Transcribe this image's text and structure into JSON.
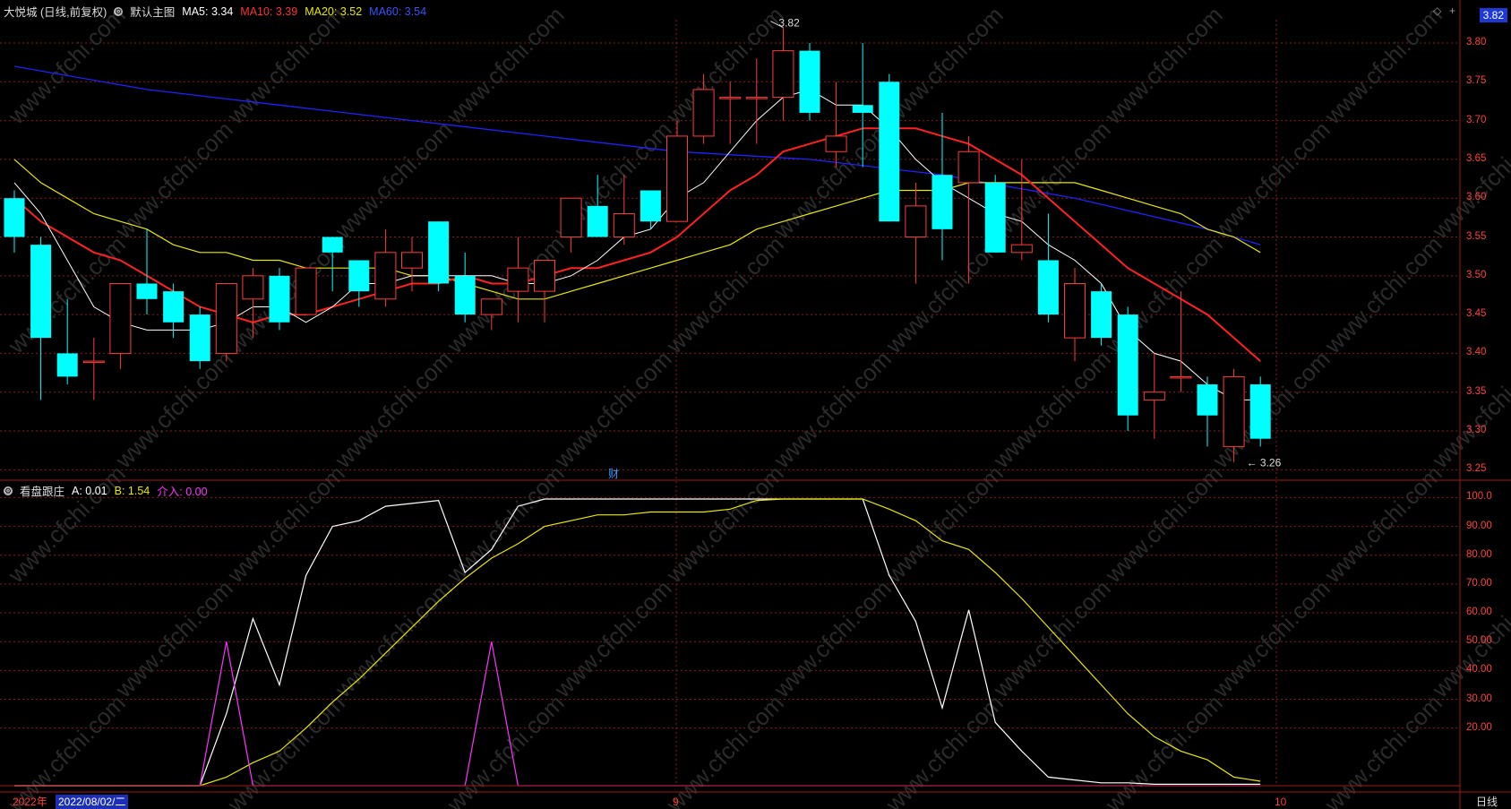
{
  "header": {
    "stock": "大悦城 (日线,前复权)",
    "main_chart_label": "默认主图",
    "ma5": "MA5: 3.34",
    "ma10": "MA10: 3.39",
    "ma20": "MA20: 3.52",
    "ma60": "MA60: 3.54"
  },
  "sub_header": {
    "name": "看盘跟庄",
    "a": "A: 0.01",
    "b": "B: 1.54",
    "jieru": "介入: 0.00"
  },
  "current_price": "3.82",
  "marks": {
    "high_label": "3.82",
    "low_label": "3.26",
    "fin_marker": "财"
  },
  "bottom": {
    "year": "2022年",
    "date": "2022/08/02/二",
    "month_9": "9",
    "month_10": "10",
    "period": "日线"
  },
  "colors": {
    "up": "#ff3b3b",
    "down": "#00ffff",
    "ma5": "#ffffff",
    "ma10": "#ff2020",
    "ma20": "#e8e800",
    "ma60": "#2020ff",
    "grid": "#8b1a1a",
    "jieru": "#ff33ff"
  },
  "chart_data": [
    {
      "type": "candlestick",
      "ylim": [
        3.24,
        3.83
      ],
      "yticks": [
        "3.80",
        "3.75",
        "3.70",
        "3.65",
        "3.60",
        "3.55",
        "3.50",
        "3.45",
        "3.40",
        "3.35",
        "3.30",
        "3.25"
      ],
      "candles": [
        {
          "o": 3.6,
          "h": 3.61,
          "l": 3.53,
          "c": 3.55
        },
        {
          "o": 3.54,
          "h": 3.55,
          "l": 3.34,
          "c": 3.42
        },
        {
          "o": 3.4,
          "h": 3.47,
          "l": 3.36,
          "c": 3.37
        },
        {
          "o": 3.39,
          "h": 3.42,
          "l": 3.34,
          "c": 3.39
        },
        {
          "o": 3.4,
          "h": 3.49,
          "l": 3.38,
          "c": 3.49
        },
        {
          "o": 3.49,
          "h": 3.56,
          "l": 3.45,
          "c": 3.47
        },
        {
          "o": 3.48,
          "h": 3.49,
          "l": 3.42,
          "c": 3.44
        },
        {
          "o": 3.45,
          "h": 3.46,
          "l": 3.38,
          "c": 3.39
        },
        {
          "o": 3.4,
          "h": 3.49,
          "l": 3.39,
          "c": 3.49
        },
        {
          "o": 3.47,
          "h": 3.51,
          "l": 3.42,
          "c": 3.5
        },
        {
          "o": 3.5,
          "h": 3.51,
          "l": 3.43,
          "c": 3.44
        },
        {
          "o": 3.45,
          "h": 3.51,
          "l": 3.45,
          "c": 3.51
        },
        {
          "o": 3.55,
          "h": 3.55,
          "l": 3.48,
          "c": 3.53
        },
        {
          "o": 3.52,
          "h": 3.52,
          "l": 3.46,
          "c": 3.48
        },
        {
          "o": 3.47,
          "h": 3.56,
          "l": 3.46,
          "c": 3.53
        },
        {
          "o": 3.51,
          "h": 3.55,
          "l": 3.48,
          "c": 3.53
        },
        {
          "o": 3.57,
          "h": 3.57,
          "l": 3.48,
          "c": 3.49
        },
        {
          "o": 3.5,
          "h": 3.53,
          "l": 3.44,
          "c": 3.45
        },
        {
          "o": 3.45,
          "h": 3.47,
          "l": 3.43,
          "c": 3.47
        },
        {
          "o": 3.48,
          "h": 3.55,
          "l": 3.44,
          "c": 3.51
        },
        {
          "o": 3.48,
          "h": 3.51,
          "l": 3.44,
          "c": 3.52
        },
        {
          "o": 3.55,
          "h": 3.6,
          "l": 3.53,
          "c": 3.6
        },
        {
          "o": 3.59,
          "h": 3.63,
          "l": 3.55,
          "c": 3.55
        },
        {
          "o": 3.55,
          "h": 3.63,
          "l": 3.54,
          "c": 3.58
        },
        {
          "o": 3.61,
          "h": 3.61,
          "l": 3.56,
          "c": 3.57
        },
        {
          "o": 3.57,
          "h": 3.7,
          "l": 3.57,
          "c": 3.68
        },
        {
          "o": 3.68,
          "h": 3.76,
          "l": 3.67,
          "c": 3.74
        },
        {
          "o": 3.73,
          "h": 3.75,
          "l": 3.67,
          "c": 3.73
        },
        {
          "o": 3.73,
          "h": 3.78,
          "l": 3.67,
          "c": 3.73
        },
        {
          "o": 3.73,
          "h": 3.82,
          "l": 3.7,
          "c": 3.79
        },
        {
          "o": 3.79,
          "h": 3.8,
          "l": 3.7,
          "c": 3.71
        },
        {
          "o": 3.66,
          "h": 3.75,
          "l": 3.64,
          "c": 3.68
        },
        {
          "o": 3.72,
          "h": 3.8,
          "l": 3.64,
          "c": 3.71
        },
        {
          "o": 3.75,
          "h": 3.76,
          "l": 3.57,
          "c": 3.57
        },
        {
          "o": 3.55,
          "h": 3.62,
          "l": 3.49,
          "c": 3.59
        },
        {
          "o": 3.63,
          "h": 3.71,
          "l": 3.52,
          "c": 3.56
        },
        {
          "o": 3.62,
          "h": 3.68,
          "l": 3.49,
          "c": 3.66
        },
        {
          "o": 3.62,
          "h": 3.63,
          "l": 3.53,
          "c": 3.53
        },
        {
          "o": 3.53,
          "h": 3.65,
          "l": 3.52,
          "c": 3.54
        },
        {
          "o": 3.52,
          "h": 3.58,
          "l": 3.44,
          "c": 3.45
        },
        {
          "o": 3.42,
          "h": 3.51,
          "l": 3.39,
          "c": 3.49
        },
        {
          "o": 3.48,
          "h": 3.49,
          "l": 3.41,
          "c": 3.42
        },
        {
          "o": 3.45,
          "h": 3.46,
          "l": 3.3,
          "c": 3.32
        },
        {
          "o": 3.34,
          "h": 3.4,
          "l": 3.29,
          "c": 3.35
        },
        {
          "o": 3.37,
          "h": 3.48,
          "l": 3.35,
          "c": 3.37
        },
        {
          "o": 3.36,
          "h": 3.37,
          "l": 3.28,
          "c": 3.32
        },
        {
          "o": 3.28,
          "h": 3.38,
          "l": 3.26,
          "c": 3.37
        },
        {
          "o": 3.36,
          "h": 3.37,
          "l": 3.28,
          "c": 3.29
        }
      ],
      "ma5": [
        3.62,
        3.58,
        3.52,
        3.46,
        3.44,
        3.43,
        3.43,
        3.43,
        3.44,
        3.46,
        3.46,
        3.44,
        3.46,
        3.49,
        3.49,
        3.5,
        3.5,
        3.5,
        3.5,
        3.49,
        3.49,
        3.5,
        3.52,
        3.55,
        3.56,
        3.6,
        3.62,
        3.66,
        3.7,
        3.73,
        3.74,
        3.72,
        3.72,
        3.69,
        3.65,
        3.62,
        3.6,
        3.58,
        3.57,
        3.54,
        3.52,
        3.49,
        3.43,
        3.4,
        3.39,
        3.36,
        3.34,
        3.34
      ],
      "ma10": [
        3.6,
        3.57,
        3.55,
        3.53,
        3.52,
        3.5,
        3.48,
        3.46,
        3.45,
        3.44,
        3.45,
        3.45,
        3.46,
        3.47,
        3.48,
        3.49,
        3.49,
        3.5,
        3.49,
        3.49,
        3.5,
        3.51,
        3.51,
        3.52,
        3.53,
        3.55,
        3.58,
        3.61,
        3.63,
        3.66,
        3.67,
        3.68,
        3.69,
        3.69,
        3.69,
        3.68,
        3.67,
        3.65,
        3.63,
        3.6,
        3.57,
        3.54,
        3.51,
        3.49,
        3.47,
        3.45,
        3.42,
        3.39
      ],
      "ma20": [
        3.65,
        3.62,
        3.6,
        3.58,
        3.57,
        3.56,
        3.54,
        3.53,
        3.53,
        3.52,
        3.52,
        3.51,
        3.51,
        3.51,
        3.51,
        3.5,
        3.5,
        3.49,
        3.48,
        3.47,
        3.47,
        3.48,
        3.49,
        3.5,
        3.51,
        3.52,
        3.53,
        3.54,
        3.56,
        3.57,
        3.58,
        3.59,
        3.6,
        3.61,
        3.61,
        3.61,
        3.62,
        3.62,
        3.62,
        3.62,
        3.62,
        3.61,
        3.6,
        3.59,
        3.58,
        3.56,
        3.55,
        3.53
      ],
      "ma60": [
        {
          "i": 0,
          "v": 3.77
        },
        {
          "i": 5,
          "v": 3.74
        },
        {
          "i": 10,
          "v": 3.72
        },
        {
          "i": 15,
          "v": 3.7
        },
        {
          "i": 20,
          "v": 3.68
        },
        {
          "i": 25,
          "v": 3.66
        },
        {
          "i": 30,
          "v": 3.65
        },
        {
          "i": 35,
          "v": 3.63
        },
        {
          "i": 40,
          "v": 3.6
        },
        {
          "i": 45,
          "v": 3.56
        },
        {
          "i": 47,
          "v": 3.54
        }
      ]
    },
    {
      "type": "line",
      "title": "看盘跟庄",
      "ylim": [
        0,
        102
      ],
      "yticks": [
        "100.0",
        "90.00",
        "80.00",
        "70.00",
        "60.00",
        "50.00",
        "40.00",
        "30.00",
        "20.00"
      ],
      "series": [
        {
          "name": "A",
          "values": [
            0,
            0,
            0,
            0,
            0,
            0,
            0,
            0,
            25,
            58,
            35,
            73,
            90,
            92,
            97,
            98,
            99,
            74,
            82,
            97,
            99.5,
            99.5,
            99.5,
            99.5,
            99.5,
            99.5,
            99.5,
            99.5,
            99.5,
            99.5,
            99.5,
            99.5,
            99.5,
            73,
            57,
            27,
            61,
            22,
            12,
            3,
            2,
            1,
            1,
            0.5,
            0.5,
            0.5,
            0.5,
            0.5
          ]
        },
        {
          "name": "B",
          "values": [
            0,
            0,
            0,
            0,
            0,
            0,
            0,
            0,
            3,
            8,
            12,
            20,
            29,
            37,
            46,
            55,
            64,
            72,
            79,
            84,
            90,
            92,
            94,
            94,
            95,
            95,
            95,
            96,
            99,
            99.5,
            99.5,
            99.5,
            99.5,
            96,
            92,
            85,
            82,
            74,
            65,
            55,
            45,
            35,
            25,
            17,
            12,
            9,
            3,
            1.54
          ]
        },
        {
          "name": "介入",
          "values": [
            0,
            0,
            0,
            0,
            0,
            0,
            0,
            0,
            50,
            0,
            0,
            0,
            0,
            0,
            0,
            0,
            0,
            0,
            50,
            0,
            0,
            0,
            0,
            0,
            0,
            0,
            0,
            0,
            0,
            0,
            0,
            0,
            0,
            0,
            0,
            0,
            0,
            0,
            0,
            0,
            0,
            0,
            0,
            0,
            0,
            0,
            0,
            0
          ]
        }
      ]
    }
  ]
}
